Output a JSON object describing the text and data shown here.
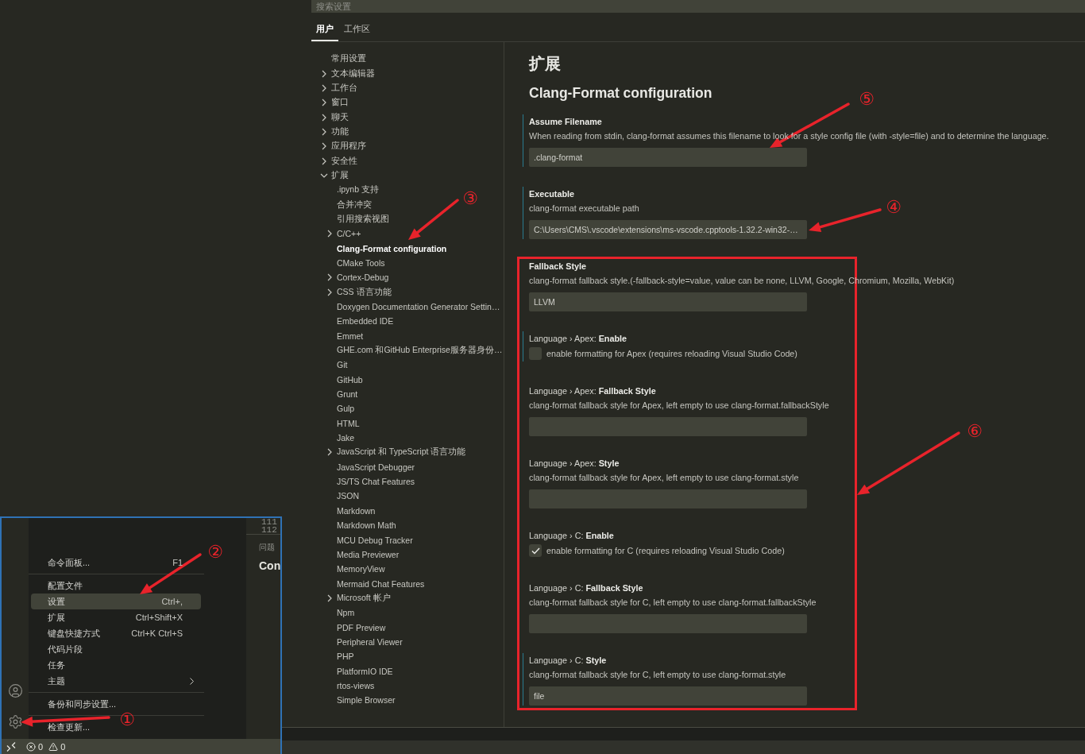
{
  "search": {
    "placeholder": "搜索设置"
  },
  "tabs": [
    {
      "label": "用户",
      "selected": true
    },
    {
      "label": "工作区",
      "selected": false
    }
  ],
  "toc": {
    "items": [
      {
        "label": "常用设置",
        "kind": "leaf",
        "selected": false
      },
      {
        "label": "文本编辑器",
        "kind": "group",
        "expanded": false,
        "selected": false
      },
      {
        "label": "工作台",
        "kind": "group",
        "expanded": false,
        "selected": false
      },
      {
        "label": "窗口",
        "kind": "group",
        "expanded": false,
        "selected": false
      },
      {
        "label": "聊天",
        "kind": "group",
        "expanded": false,
        "selected": false
      },
      {
        "label": "功能",
        "kind": "group",
        "expanded": false,
        "selected": false
      },
      {
        "label": "应用程序",
        "kind": "group",
        "expanded": false,
        "selected": false
      },
      {
        "label": "安全性",
        "kind": "group",
        "expanded": false,
        "selected": false
      },
      {
        "label": "扩展",
        "kind": "group",
        "expanded": true,
        "selected": false,
        "children": [
          {
            "label": ".ipynb 支持",
            "kind": "leaf",
            "selected": false
          },
          {
            "label": "合并冲突",
            "kind": "leaf",
            "selected": false
          },
          {
            "label": "引用搜索视图",
            "kind": "leaf",
            "selected": false
          },
          {
            "label": "C/C++",
            "kind": "group",
            "expanded": false,
            "selected": false
          },
          {
            "label": "Clang-Format configuration",
            "kind": "leaf",
            "selected": true
          },
          {
            "label": "CMake Tools",
            "kind": "leaf",
            "selected": false
          },
          {
            "label": "Cortex-Debug",
            "kind": "group",
            "expanded": false,
            "selected": false
          },
          {
            "label": "CSS 语言功能",
            "kind": "group",
            "expanded": false,
            "selected": false
          },
          {
            "label": "Doxygen Documentation Generator Settin…",
            "kind": "leaf",
            "selected": false
          },
          {
            "label": "Embedded IDE",
            "kind": "leaf",
            "selected": false
          },
          {
            "label": "Emmet",
            "kind": "leaf",
            "selected": false
          },
          {
            "label": "GHE.com 和GitHub Enterprise服务器身份…",
            "kind": "leaf",
            "selected": false
          },
          {
            "label": "Git",
            "kind": "leaf",
            "selected": false
          },
          {
            "label": "GitHub",
            "kind": "leaf",
            "selected": false
          },
          {
            "label": "Grunt",
            "kind": "leaf",
            "selected": false
          },
          {
            "label": "Gulp",
            "kind": "leaf",
            "selected": false
          },
          {
            "label": "HTML",
            "kind": "leaf",
            "selected": false
          },
          {
            "label": "Jake",
            "kind": "leaf",
            "selected": false
          },
          {
            "label": "JavaScript 和 TypeScript 语言功能",
            "kind": "group",
            "expanded": false,
            "selected": false
          },
          {
            "label": "JavaScript Debugger",
            "kind": "leaf",
            "selected": false
          },
          {
            "label": "JS/TS Chat Features",
            "kind": "leaf",
            "selected": false
          },
          {
            "label": "JSON",
            "kind": "leaf",
            "selected": false
          },
          {
            "label": "Markdown",
            "kind": "leaf",
            "selected": false
          },
          {
            "label": "Markdown Math",
            "kind": "leaf",
            "selected": false
          },
          {
            "label": "MCU Debug Tracker",
            "kind": "leaf",
            "selected": false
          },
          {
            "label": "Media Previewer",
            "kind": "leaf",
            "selected": false
          },
          {
            "label": "MemoryView",
            "kind": "leaf",
            "selected": false
          },
          {
            "label": "Mermaid Chat Features",
            "kind": "leaf",
            "selected": false
          },
          {
            "label": "Microsoft 帐户",
            "kind": "group",
            "expanded": false,
            "selected": false
          },
          {
            "label": "Npm",
            "kind": "leaf",
            "selected": false
          },
          {
            "label": "PDF Preview",
            "kind": "leaf",
            "selected": false
          },
          {
            "label": "Peripheral Viewer",
            "kind": "leaf",
            "selected": false
          },
          {
            "label": "PHP",
            "kind": "leaf",
            "selected": false
          },
          {
            "label": "PlatformIO IDE",
            "kind": "leaf",
            "selected": false
          },
          {
            "label": "rtos-views",
            "kind": "leaf",
            "selected": false
          },
          {
            "label": "Simple Browser",
            "kind": "leaf",
            "selected": false
          }
        ]
      }
    ]
  },
  "content": {
    "section": "扩展",
    "title": "Clang-Format configuration",
    "settings": [
      {
        "kind": "text",
        "name": "Assume Filename",
        "description": "When reading from stdin, clang-format assumes this filename to look for a style config file (with -style=file) and to determine the language.",
        "value": ".clang-format",
        "modified": true
      },
      {
        "kind": "text",
        "name": "Executable",
        "description": "clang-format executable path",
        "value": "C:\\Users\\CMS\\.vscode\\extensions\\ms-vscode.cpptools-1.32.2-win32-…",
        "modified": true
      },
      {
        "kind": "text",
        "name": "Fallback Style",
        "description": "clang-format fallback style.(-fallback-style=value, value can be none, LLVM, Google, Chromium, Mozilla, WebKit)",
        "value": "LLVM",
        "modified": false
      },
      {
        "kind": "checkbox",
        "category": "Language › Apex: ",
        "name": "Enable",
        "description": "enable formatting for Apex (requires reloading Visual Studio Code)",
        "checked": false,
        "modified": true
      },
      {
        "kind": "text",
        "category": "Language › Apex: ",
        "name": "Fallback Style",
        "description": "clang-format fallback style for Apex, left empty to use clang-format.fallbackStyle",
        "modified": false
      },
      {
        "kind": "text",
        "category": "Language › Apex: ",
        "name": "Style",
        "description": "clang-format fallback style for Apex, left empty to use clang-format.style",
        "modified": false
      },
      {
        "kind": "checkbox",
        "category": "Language › C: ",
        "name": "Enable",
        "description": "enable formatting for C (requires reloading Visual Studio Code)",
        "checked": true,
        "modified": false
      },
      {
        "kind": "text",
        "category": "Language › C: ",
        "name": "Fallback Style",
        "description": "clang-format fallback style for C, left empty to use clang-format.fallbackStyle",
        "modified": false
      },
      {
        "kind": "text",
        "category": "Language › C: ",
        "name": "Style",
        "description": "clang-format fallback style for C, left empty to use clang-format.style",
        "value": "file",
        "modified": true
      }
    ]
  },
  "inset": {
    "menu": {
      "items": [
        {
          "kind": "item",
          "label": "命令面板...",
          "shortcut": "F1",
          "selected": false,
          "submenu": false
        },
        {
          "kind": "separator"
        },
        {
          "kind": "item",
          "label": "配置文件",
          "selected": false,
          "submenu": false
        },
        {
          "kind": "item",
          "label": "设置",
          "shortcut": "Ctrl+,",
          "selected": true,
          "submenu": false
        },
        {
          "kind": "item",
          "label": "扩展",
          "shortcut": "Ctrl+Shift+X",
          "selected": false,
          "submenu": false
        },
        {
          "kind": "item",
          "label": "键盘快捷方式",
          "shortcut": "Ctrl+K Ctrl+S",
          "selected": false,
          "submenu": false
        },
        {
          "kind": "item",
          "label": "代码片段",
          "selected": false,
          "submenu": false
        },
        {
          "kind": "item",
          "label": "任务",
          "selected": false,
          "submenu": false
        },
        {
          "kind": "item",
          "label": "主题",
          "selected": false,
          "submenu": true
        },
        {
          "kind": "separator"
        },
        {
          "kind": "item",
          "label": "备份和同步设置...",
          "selected": false,
          "submenu": false
        },
        {
          "kind": "separator"
        },
        {
          "kind": "item",
          "label": "检查更新...",
          "selected": false,
          "submenu": false
        }
      ]
    },
    "editor": {
      "line_numbers": [
        "111",
        "112"
      ],
      "panel_tab": "问题",
      "text": "Con"
    },
    "status_bar": {
      "errors": "0",
      "warnings": "0"
    }
  },
  "annotations": [
    {
      "label": "①"
    },
    {
      "label": "②"
    },
    {
      "label": "③"
    },
    {
      "label": "④"
    },
    {
      "label": "⑤"
    },
    {
      "label": "⑥"
    }
  ]
}
